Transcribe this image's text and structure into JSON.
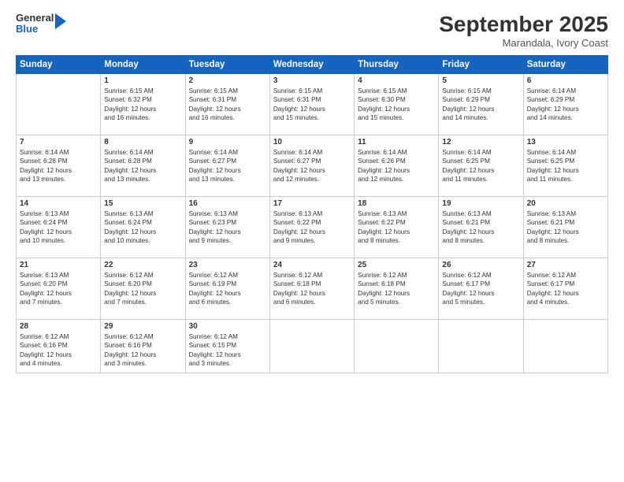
{
  "header": {
    "logo_general": "General",
    "logo_blue": "Blue",
    "month": "September 2025",
    "location": "Marandala, Ivory Coast"
  },
  "weekdays": [
    "Sunday",
    "Monday",
    "Tuesday",
    "Wednesday",
    "Thursday",
    "Friday",
    "Saturday"
  ],
  "weeks": [
    [
      {
        "day": "",
        "text": ""
      },
      {
        "day": "1",
        "text": "Sunrise: 6:15 AM\nSunset: 6:32 PM\nDaylight: 12 hours\nand 16 minutes."
      },
      {
        "day": "2",
        "text": "Sunrise: 6:15 AM\nSunset: 6:31 PM\nDaylight: 12 hours\nand 16 minutes."
      },
      {
        "day": "3",
        "text": "Sunrise: 6:15 AM\nSunset: 6:31 PM\nDaylight: 12 hours\nand 15 minutes."
      },
      {
        "day": "4",
        "text": "Sunrise: 6:15 AM\nSunset: 6:30 PM\nDaylight: 12 hours\nand 15 minutes."
      },
      {
        "day": "5",
        "text": "Sunrise: 6:15 AM\nSunset: 6:29 PM\nDaylight: 12 hours\nand 14 minutes."
      },
      {
        "day": "6",
        "text": "Sunrise: 6:14 AM\nSunset: 6:29 PM\nDaylight: 12 hours\nand 14 minutes."
      }
    ],
    [
      {
        "day": "7",
        "text": "Sunrise: 6:14 AM\nSunset: 6:28 PM\nDaylight: 12 hours\nand 13 minutes."
      },
      {
        "day": "8",
        "text": "Sunrise: 6:14 AM\nSunset: 6:28 PM\nDaylight: 12 hours\nand 13 minutes."
      },
      {
        "day": "9",
        "text": "Sunrise: 6:14 AM\nSunset: 6:27 PM\nDaylight: 12 hours\nand 13 minutes."
      },
      {
        "day": "10",
        "text": "Sunrise: 6:14 AM\nSunset: 6:27 PM\nDaylight: 12 hours\nand 12 minutes."
      },
      {
        "day": "11",
        "text": "Sunrise: 6:14 AM\nSunset: 6:26 PM\nDaylight: 12 hours\nand 12 minutes."
      },
      {
        "day": "12",
        "text": "Sunrise: 6:14 AM\nSunset: 6:25 PM\nDaylight: 12 hours\nand 11 minutes."
      },
      {
        "day": "13",
        "text": "Sunrise: 6:14 AM\nSunset: 6:25 PM\nDaylight: 12 hours\nand 11 minutes."
      }
    ],
    [
      {
        "day": "14",
        "text": "Sunrise: 6:13 AM\nSunset: 6:24 PM\nDaylight: 12 hours\nand 10 minutes."
      },
      {
        "day": "15",
        "text": "Sunrise: 6:13 AM\nSunset: 6:24 PM\nDaylight: 12 hours\nand 10 minutes."
      },
      {
        "day": "16",
        "text": "Sunrise: 6:13 AM\nSunset: 6:23 PM\nDaylight: 12 hours\nand 9 minutes."
      },
      {
        "day": "17",
        "text": "Sunrise: 6:13 AM\nSunset: 6:22 PM\nDaylight: 12 hours\nand 9 minutes."
      },
      {
        "day": "18",
        "text": "Sunrise: 6:13 AM\nSunset: 6:22 PM\nDaylight: 12 hours\nand 8 minutes."
      },
      {
        "day": "19",
        "text": "Sunrise: 6:13 AM\nSunset: 6:21 PM\nDaylight: 12 hours\nand 8 minutes."
      },
      {
        "day": "20",
        "text": "Sunrise: 6:13 AM\nSunset: 6:21 PM\nDaylight: 12 hours\nand 8 minutes."
      }
    ],
    [
      {
        "day": "21",
        "text": "Sunrise: 6:13 AM\nSunset: 6:20 PM\nDaylight: 12 hours\nand 7 minutes."
      },
      {
        "day": "22",
        "text": "Sunrise: 6:12 AM\nSunset: 6:20 PM\nDaylight: 12 hours\nand 7 minutes."
      },
      {
        "day": "23",
        "text": "Sunrise: 6:12 AM\nSunset: 6:19 PM\nDaylight: 12 hours\nand 6 minutes."
      },
      {
        "day": "24",
        "text": "Sunrise: 6:12 AM\nSunset: 6:18 PM\nDaylight: 12 hours\nand 6 minutes."
      },
      {
        "day": "25",
        "text": "Sunrise: 6:12 AM\nSunset: 6:18 PM\nDaylight: 12 hours\nand 5 minutes."
      },
      {
        "day": "26",
        "text": "Sunrise: 6:12 AM\nSunset: 6:17 PM\nDaylight: 12 hours\nand 5 minutes."
      },
      {
        "day": "27",
        "text": "Sunrise: 6:12 AM\nSunset: 6:17 PM\nDaylight: 12 hours\nand 4 minutes."
      }
    ],
    [
      {
        "day": "28",
        "text": "Sunrise: 6:12 AM\nSunset: 6:16 PM\nDaylight: 12 hours\nand 4 minutes."
      },
      {
        "day": "29",
        "text": "Sunrise: 6:12 AM\nSunset: 6:16 PM\nDaylight: 12 hours\nand 3 minutes."
      },
      {
        "day": "30",
        "text": "Sunrise: 6:12 AM\nSunset: 6:15 PM\nDaylight: 12 hours\nand 3 minutes."
      },
      {
        "day": "",
        "text": ""
      },
      {
        "day": "",
        "text": ""
      },
      {
        "day": "",
        "text": ""
      },
      {
        "day": "",
        "text": ""
      }
    ]
  ]
}
